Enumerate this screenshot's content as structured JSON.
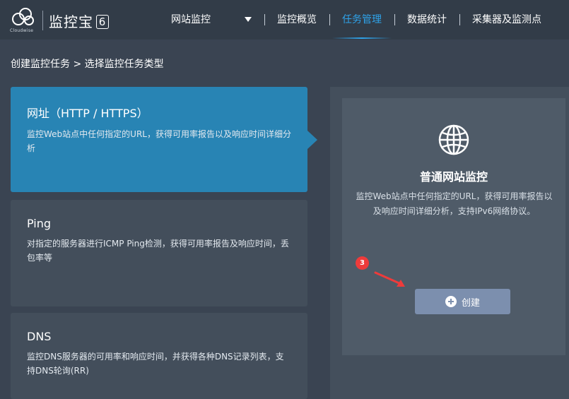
{
  "header": {
    "logo_sub": "Cloudwise",
    "logo_text": "监控宝",
    "logo_version": "6",
    "nav": [
      {
        "label": "网站监控"
      },
      {
        "label": "监控概览"
      },
      {
        "label": "任务管理"
      },
      {
        "label": "数据统计"
      },
      {
        "label": "采集器及监测点"
      }
    ]
  },
  "breadcrumb": "创建监控任务 > 选择监控任务类型",
  "types": [
    {
      "title": "网址（HTTP / HTTPS）",
      "desc": "监控Web站点中任何指定的URL，获得可用率报告以及响应时间详细分析"
    },
    {
      "title": "Ping",
      "desc": "对指定的服务器进行ICMP Ping检测，获得可用率报告及响应时间，丢包率等"
    },
    {
      "title": "DNS",
      "desc": "监控DNS服务器的可用率和响应时间，并获得各种DNS记录列表，支持DNS轮询(RR)"
    }
  ],
  "panel": {
    "title": "普通网站监控",
    "desc": "监控Web站点中任何指定的URL，获得可用率报告以及响应时间详细分析，支持IPv6网络协议。",
    "create_label": "创建"
  },
  "annotation": {
    "step": "3"
  },
  "colors": {
    "header_bg": "#323c48",
    "active_nav": "#2fa3ea",
    "selected_card": "#2884b4",
    "card_bg": "#434e5b",
    "button_bg": "#7c8fae",
    "badge_red": "#ee3b3b"
  }
}
